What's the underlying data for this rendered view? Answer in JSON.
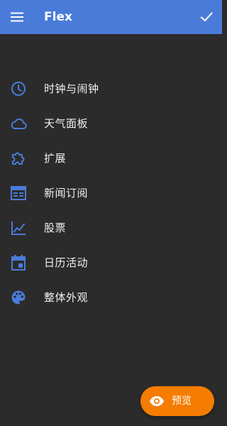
{
  "colors": {
    "app_bar": "#4a7bd9",
    "background": "#2b2b2b",
    "icon_accent": "#4a7bd9",
    "fab": "#f57c00",
    "text": "#f1f1f1"
  },
  "header": {
    "title": "Flex",
    "menu_icon": "hamburger-menu-icon",
    "confirm_icon": "check-icon"
  },
  "menu": {
    "items": [
      {
        "label": "时钟与闹钟",
        "icon": "clock-icon"
      },
      {
        "label": "天气面板",
        "icon": "cloud-icon"
      },
      {
        "label": "扩展",
        "icon": "puzzle-icon"
      },
      {
        "label": "新闻订阅",
        "icon": "news-feed-icon"
      },
      {
        "label": "股票",
        "icon": "stock-chart-icon"
      },
      {
        "label": "日历活动",
        "icon": "calendar-icon"
      },
      {
        "label": "整体外观",
        "icon": "palette-icon"
      }
    ]
  },
  "fab": {
    "label": "预览",
    "icon": "eye-icon"
  }
}
